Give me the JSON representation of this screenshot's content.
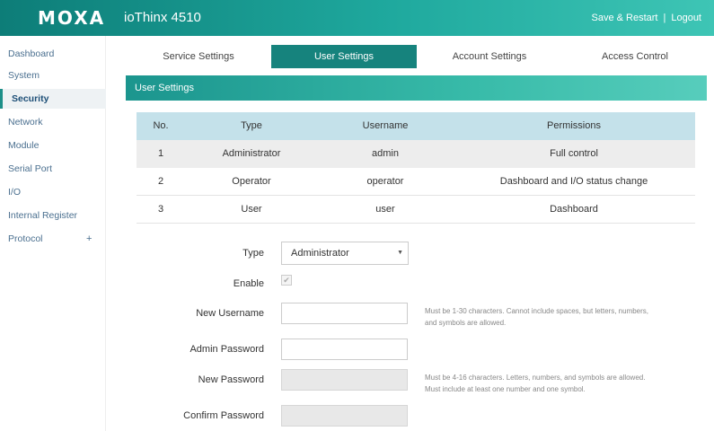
{
  "header": {
    "logo": "MOXA",
    "product": "ioThinx 4510",
    "save_restart": "Save & Restart",
    "separator": "|",
    "logout": "Logout"
  },
  "sidebar": {
    "items": [
      {
        "label": "Dashboard"
      },
      {
        "label": "System"
      },
      {
        "label": "Security"
      },
      {
        "label": "Network"
      },
      {
        "label": "Module"
      },
      {
        "label": "Serial Port"
      },
      {
        "label": "I/O"
      },
      {
        "label": "Internal Register"
      },
      {
        "label": "Protocol",
        "expand": "+"
      }
    ]
  },
  "tabs": [
    "Service Settings",
    "User Settings",
    "Account Settings",
    "Access Control"
  ],
  "section_title": "User Settings",
  "table": {
    "headers": [
      "No.",
      "Type",
      "Username",
      "Permissions"
    ],
    "rows": [
      [
        "1",
        "Administrator",
        "admin",
        "Full control"
      ],
      [
        "2",
        "Operator",
        "operator",
        "Dashboard and I/O status change"
      ],
      [
        "3",
        "User",
        "user",
        "Dashboard"
      ]
    ]
  },
  "form": {
    "type_label": "Type",
    "type_value": "Administrator",
    "enable_label": "Enable",
    "enable_checked": true,
    "new_username_label": "New Username",
    "admin_password_label": "Admin Password",
    "new_password_label": "New Password",
    "confirm_password_label": "Confirm Password",
    "username_hint": "Must be 1-30 characters. Cannot include spaces, but letters, numbers, and symbols are allowed.",
    "password_hint": "Must be 4-16 characters. Letters, numbers, and symbols are allowed. Must include at least one number and one symbol."
  },
  "colors": {
    "brand": "#16837d",
    "table_header": "#c4e1ea",
    "nav_text": "#4a6f8f"
  }
}
